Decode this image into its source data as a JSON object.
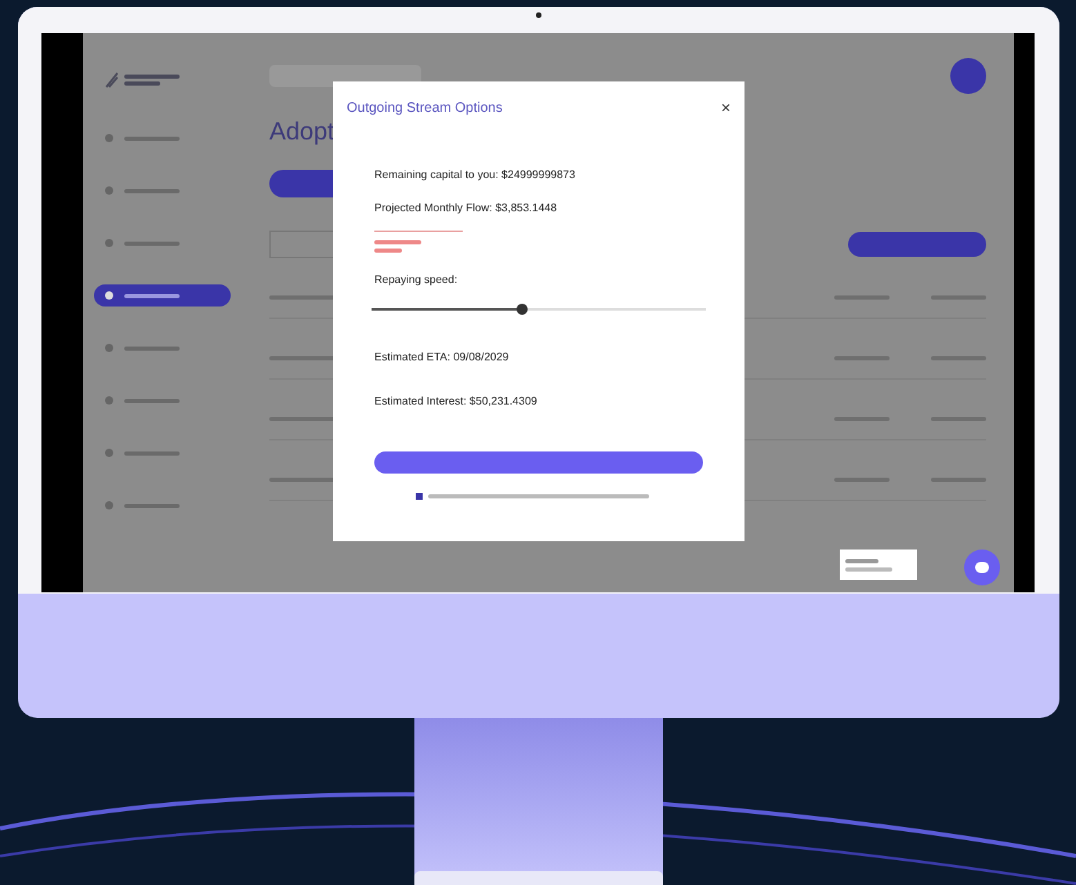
{
  "page": {
    "heading": "Adopt"
  },
  "sidebar": {
    "items": [
      {
        "selected": false
      },
      {
        "selected": false
      },
      {
        "selected": false
      },
      {
        "selected": true
      },
      {
        "selected": false
      },
      {
        "selected": false
      },
      {
        "selected": false
      },
      {
        "selected": false
      }
    ]
  },
  "modal": {
    "title": "Outgoing Stream Options",
    "close": "×",
    "lines": [
      "Remaining capital to you: $24999999873",
      "Projected Monthly Flow: $3,853.1448"
    ],
    "slider": {
      "label": "Repaying speed:",
      "level": 0.45
    },
    "results": [
      "Estimated ETA: 09/08/2029",
      "Estimated Interest: $50,231.4309"
    ],
    "consent": {
      "checked": true
    }
  }
}
